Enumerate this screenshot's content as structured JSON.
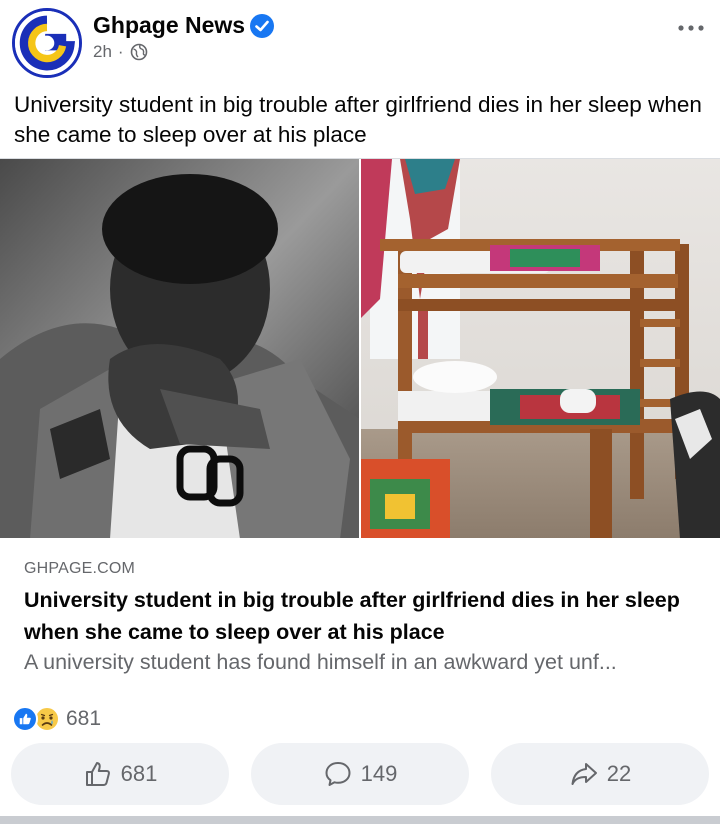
{
  "post": {
    "page_name": "Ghpage News",
    "time": "2h",
    "separator": "·",
    "caption": "University student in big trouble after girlfriend dies in her sleep when she came to sleep over at his place"
  },
  "link": {
    "domain": "GHPAGE.COM",
    "title": "University student in big trouble after girlfriend dies in her sleep when she came to sleep over at his place",
    "description": "A university student has found himself in an awkward yet unf..."
  },
  "reactions": {
    "types": [
      "like-icon",
      "sad-face-icon"
    ],
    "count": "681"
  },
  "actions": {
    "like_count": "681",
    "comment_count": "149",
    "share_count": "22"
  },
  "colors": {
    "brand_blue": "#1877f2",
    "secondary_text": "#65676b",
    "button_bg": "#f0f2f5",
    "logo_blue": "#1a2fb8",
    "logo_yellow": "#f5c518"
  }
}
